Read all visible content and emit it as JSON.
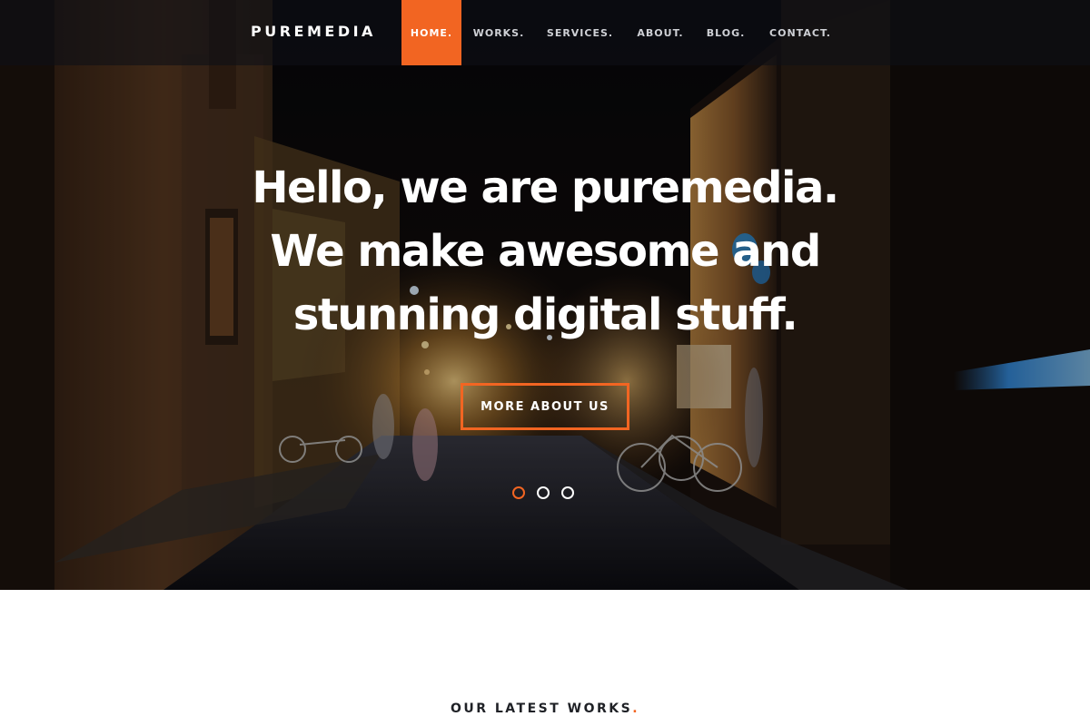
{
  "colors": {
    "accent": "#f26522",
    "nav_background": "#0e1016",
    "text_dark": "#1f2126",
    "text_light": "#ffffff"
  },
  "navbar": {
    "brand": "PUREMEDIA",
    "items": [
      {
        "label": "HOME.",
        "active": true
      },
      {
        "label": "WORKS.",
        "active": false
      },
      {
        "label": "SERVICES.",
        "active": false
      },
      {
        "label": "ABOUT.",
        "active": false
      },
      {
        "label": "BLOG.",
        "active": false
      },
      {
        "label": "CONTACT.",
        "active": false
      }
    ]
  },
  "hero": {
    "background_image": "night-street-photo",
    "title_lines": [
      "Hello, we are puremedia.",
      "We make awesome and",
      "stunning digital stuff."
    ],
    "cta_label": "MORE ABOUT US",
    "slides_total": 3,
    "active_slide": 1
  },
  "works": {
    "title": "OUR LATEST WORKS",
    "title_accent": "."
  }
}
